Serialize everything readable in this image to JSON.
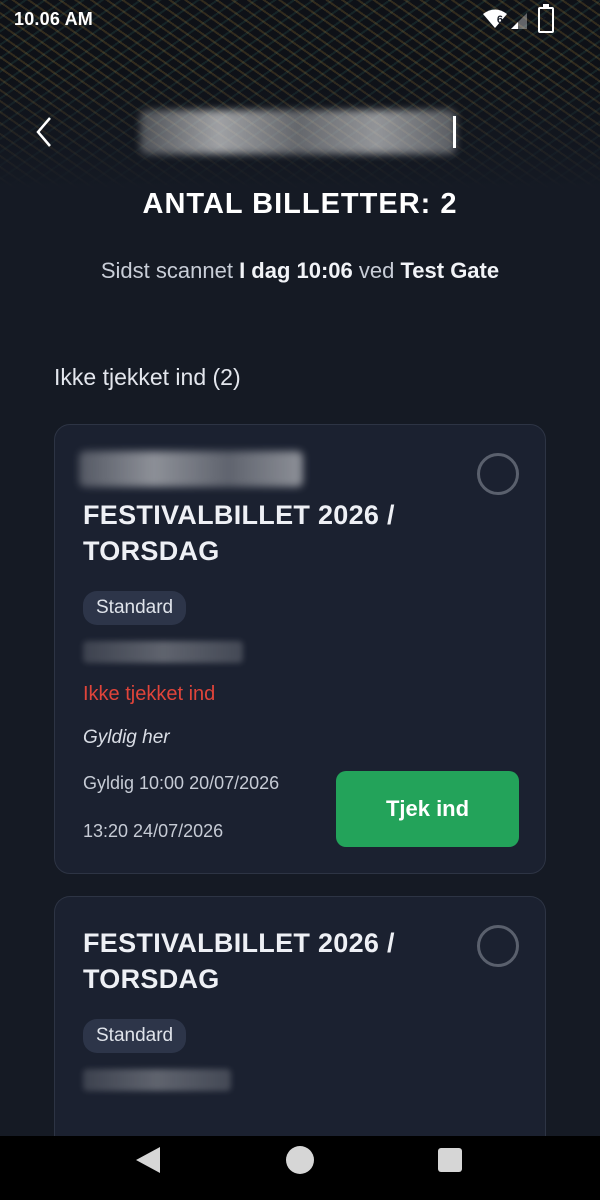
{
  "status_bar": {
    "time": "10.06 AM",
    "wifi_badge": "6"
  },
  "header": {
    "count_label": "ANTAL BILLETTER: 2",
    "last_scanned_prefix": "Sidst scannet ",
    "last_scanned_time": "I dag 10:06",
    "last_scanned_mid": " ved ",
    "last_scanned_gate": "Test Gate"
  },
  "section_title": "Ikke tjekket ind (2)",
  "tickets": [
    {
      "title": "FESTIVALBILLET 2026 / TORSDAG",
      "type": "Standard",
      "status": "Ikke tjekket ind",
      "valid_here": "Gyldig her",
      "valid_from": "Gyldig 10:00 20/07/2026",
      "valid_to": "13:20 24/07/2026",
      "checkin_label": "Tjek ind"
    },
    {
      "title": "FESTIVALBILLET 2026 / TORSDAG",
      "type": "Standard"
    }
  ],
  "colors": {
    "background": "#151a24",
    "card": "#1b2130",
    "accent_green": "#23a35a",
    "status_red": "#e0443a"
  },
  "icons": [
    "back-arrow-icon",
    "wifi-icon",
    "signal-icon",
    "battery-charging-icon",
    "radio-unchecked-icon",
    "nav-back-icon",
    "nav-home-icon",
    "nav-recents-icon"
  ]
}
